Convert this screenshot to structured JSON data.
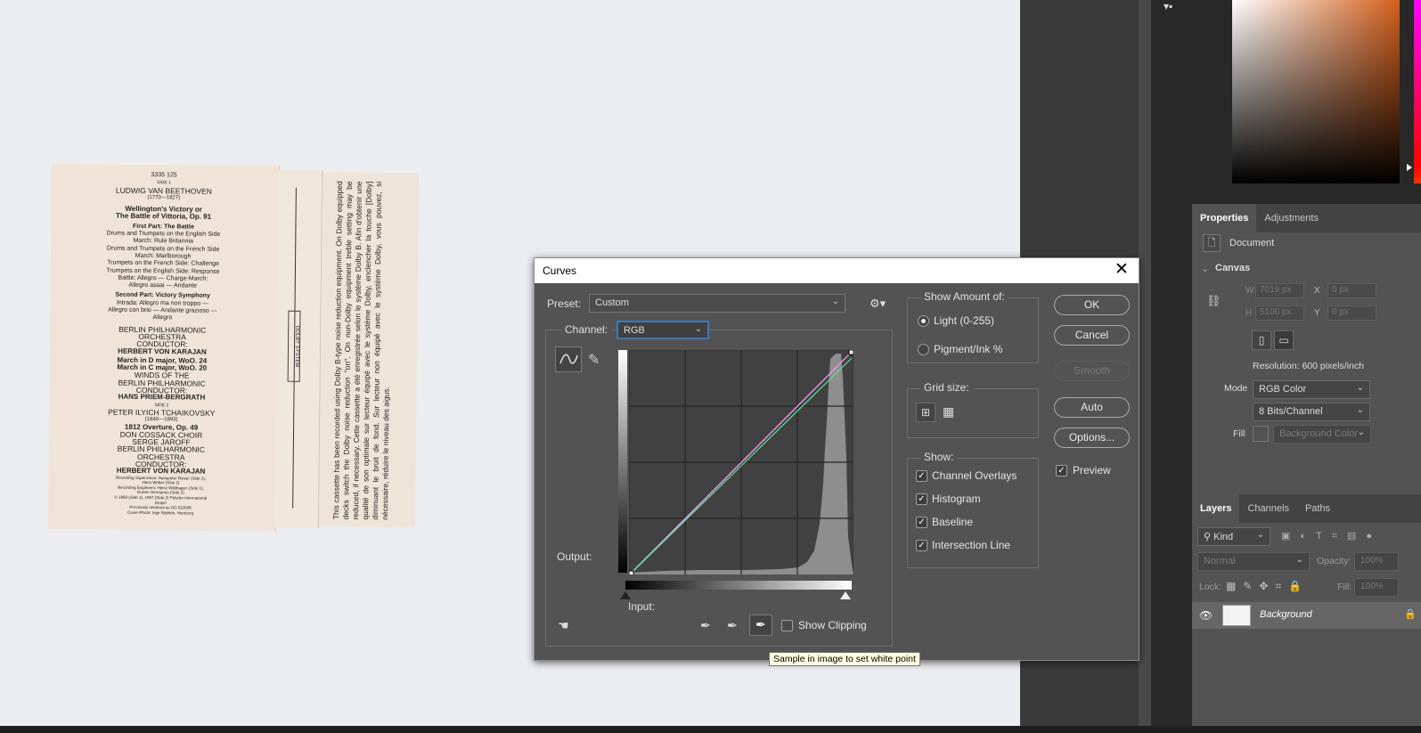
{
  "insert": {
    "catalog": "3335 125",
    "side1": "SIDE 1",
    "composer1": "LUDWIG VAN BEETHOVEN",
    "years1": "(1770—1827)",
    "work1_line1": "Wellington's Victory or",
    "work1_line2": "The Battle of Vittoria, Op. 91",
    "part1": "First Part: The Battle",
    "part1_lines": [
      "Drums and Trumpets on the English Side",
      "March: Rule Britannia",
      "Drums and Trumpets on the French Side",
      "March: Marlborough",
      "Trumpets on the French Side: Challenge",
      "Trumpets on the English Side: Response",
      "Battle: Allegro — Charge-March:",
      "Allegro assai — Andante"
    ],
    "part2": "Second Part: Victory Symphony",
    "part2_lines": [
      "Intrada: Allegro ma non troppo —",
      "Allegro con brio — Andante grazioso —",
      "Allegro"
    ],
    "orch1": "BERLIN PHILHARMONIC",
    "orch1b": "ORCHESTRA",
    "cond_label1": "CONDUCTOR:",
    "cond1": "HERBERT VON KARAJAN",
    "march1": "March in D major, WoO. 24",
    "march2": "March in C major, WoO. 20",
    "winds": "WINDS OF THE",
    "winds2": "BERLIN PHILHARMONIC",
    "cond_label2": "CONDUCTOR:",
    "cond2": "HANS PRIEM-BERGRATH",
    "side2": "SIDE 2",
    "composer2": "PETER ILYICH TCHAIKOVSKY",
    "years2": "(1840—1893)",
    "work2": "1812 Overture, Op. 49",
    "choir": "DON COSSACK CHOIR",
    "choir2": "SERGE JAROFF",
    "orch2": "BERLIN PHILHARMONIC",
    "orch2b": "ORCHESTRA",
    "cond_label3": "CONDUCTOR:",
    "cond3": "HERBERT VON KARAJAN",
    "credits": [
      "Recording Supervision: Hanspeter Reiser (Side 1),",
      "Hans Weber (Side 2)",
      "Recording Engineers: Heinz Wildhagen (Side 1),",
      "Gunter Hermanns (Side 2)",
      "© 1968 (Side 1), 1967 (Side 2) Polydor International",
      "GmbH",
      "Previously released as DG 923045",
      "Cover-Photo: Inge Rabitek, Hamburg"
    ],
    "dolby": "DOLBY SYSTEM",
    "notes": "This cassette has been recorded using Dolby B-type noise reduction equipment. On Dolby equipped decks switch the Dolby noise reduction \"on\". On non-Dolby equipment treble setting may be reduced, if necessary. Cette cassette a été enregistrée selon le système Dolby B. Afin d'obtenir une qualité de son optimale sur lecteur équipé avec le système Dolby, enclencher la touche [Dolby] diminuant le bruit de fond. Sur lecteur non équipé avec le système Dolby, vous pouvez, si nécessaire, réduire le niveau des aigus."
  },
  "colors": {
    "accent": "#d35f1c",
    "dialog_bg": "#535353",
    "curve_pink": "#ff9bff",
    "curve_green": "#55e49a"
  },
  "properties_panel": {
    "tabs": [
      "Properties",
      "Adjustments"
    ],
    "doc_label": "Document",
    "canvas_label": "Canvas",
    "w_label": "W",
    "w_value": "7019 px",
    "h_label": "H",
    "h_value": "5100 px",
    "x_label": "X",
    "x_value": "0 px",
    "y_label": "Y",
    "y_value": "0 px",
    "resolution": "Resolution: 600 pixels/inch",
    "mode_label": "Mode",
    "mode_value": "RGB Color",
    "bits_value": "8 Bits/Channel",
    "fill_label": "Fill",
    "fill_value": "Background Color"
  },
  "layers_panel": {
    "tabs": [
      "Layers",
      "Channels",
      "Paths"
    ],
    "kind": "Kind",
    "blend": "Normal",
    "opacity_label": "Opacity:",
    "opacity_value": "100%",
    "lock_label": "Lock:",
    "fill_label": "Fill:",
    "fill_value": "100%",
    "layer_name": "Background"
  },
  "curves": {
    "title": "Curves",
    "preset_label": "Preset:",
    "preset_value": "Custom",
    "channel_label": "Channel:",
    "channel_value": "RGB",
    "output_label": "Output:",
    "input_label": "Input:",
    "show_clipping": "Show Clipping",
    "show_amount_title": "Show Amount of:",
    "light_label": "Light  (0-255)",
    "pigment_label": "Pigment/Ink %",
    "grid_title": "Grid size:",
    "show_title": "Show:",
    "show_options": [
      "Channel Overlays",
      "Histogram",
      "Baseline",
      "Intersection Line"
    ],
    "buttons": {
      "ok": "OK",
      "cancel": "Cancel",
      "smooth": "Smooth",
      "auto": "Auto",
      "options": "Options..."
    },
    "preview_label": "Preview",
    "tooltip": "Sample in image to set white point"
  }
}
